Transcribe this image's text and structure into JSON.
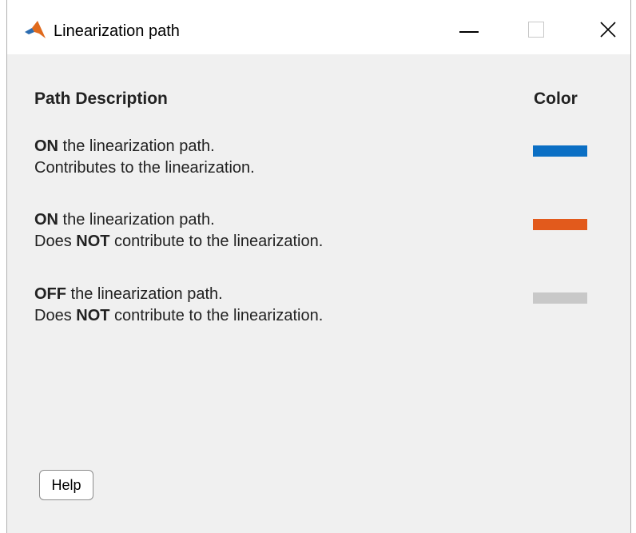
{
  "window": {
    "title": "Linearization path"
  },
  "header": {
    "description_label": "Path Description",
    "color_label": "Color"
  },
  "rows": [
    {
      "line1_bold": "ON",
      "line1_rest": " the linearization path.",
      "line2_pre": "Contributes to the linearization.",
      "line2_bold": "",
      "line2_post": "",
      "color": "#0b6fc4"
    },
    {
      "line1_bold": "ON",
      "line1_rest": " the linearization path.",
      "line2_pre": "Does ",
      "line2_bold": "NOT",
      "line2_post": " contribute to the linearization.",
      "color": "#e25a1c"
    },
    {
      "line1_bold": "OFF",
      "line1_rest": " the linearization path.",
      "line2_pre": "Does ",
      "line2_bold": "NOT",
      "line2_post": " contribute to the linearization.",
      "color": "#c8c8c8"
    }
  ],
  "footer": {
    "help_label": "Help"
  }
}
